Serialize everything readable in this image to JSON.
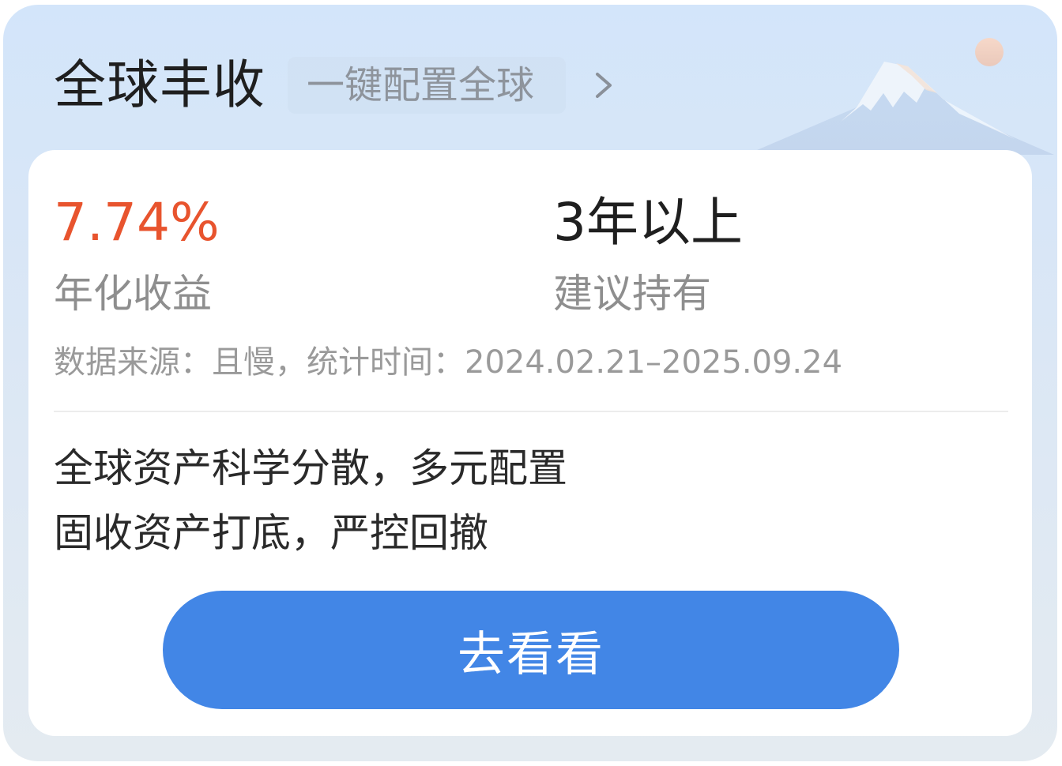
{
  "header": {
    "title": "全球丰收",
    "link_text": "一键配置全球"
  },
  "stats": {
    "annual_return_value": "7.74%",
    "annual_return_label": "年化收益",
    "holding_value": "3年以上",
    "holding_label": "建议持有"
  },
  "source_note": "数据来源：且慢，统计时间：2024.02.21–2025.09.24",
  "features": [
    "全球资产科学分散，多元配置",
    "固收资产打底，严控回撤"
  ],
  "cta": {
    "label": "去看看"
  },
  "icons": {
    "link_arrow": "chevron-right-icon",
    "decoration": "mountain-illustration"
  },
  "colors": {
    "accent_return": "#e8542e",
    "button": "#4286e6",
    "card_bg_top": "#d3e5fa"
  }
}
